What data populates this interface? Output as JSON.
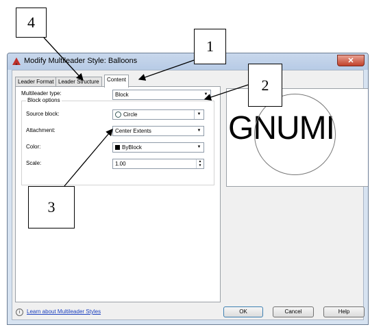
{
  "window": {
    "title": "Modify Multileader Style: Balloons",
    "close_label": "✕"
  },
  "tabs": [
    {
      "label": "Leader Format",
      "active": false
    },
    {
      "label": "Leader Structure",
      "active": false
    },
    {
      "label": "Content",
      "active": true
    }
  ],
  "content": {
    "multileader_type_label": "Multileader type:",
    "multileader_type_value": "Block",
    "block_options_title": "Block options",
    "source_block_label": "Source block:",
    "source_block_value": "Circle",
    "attachment_label": "Attachment:",
    "attachment_value": "Center Extents",
    "color_label": "Color:",
    "color_value": "ByBlock",
    "scale_label": "Scale:",
    "scale_value": "1.00"
  },
  "preview": {
    "text": "GNUMI"
  },
  "footer": {
    "info_icon": "i",
    "learn_link": "Learn about Multileader Styles",
    "ok_label": "OK",
    "cancel_label": "Cancel",
    "help_label": "Help"
  },
  "callouts": {
    "c1": "1",
    "c2": "2",
    "c3": "3",
    "c4": "4"
  },
  "icons": {
    "app": "autocad-app-icon",
    "dropdown": "chevron-down-icon",
    "spinner": "spinner-arrows-icon",
    "info": "info-icon"
  },
  "colors": {
    "title_bar": "#c9d8ec",
    "close_button": "#c1412b",
    "link": "#1a3fbf",
    "callout_border": "#000000"
  }
}
